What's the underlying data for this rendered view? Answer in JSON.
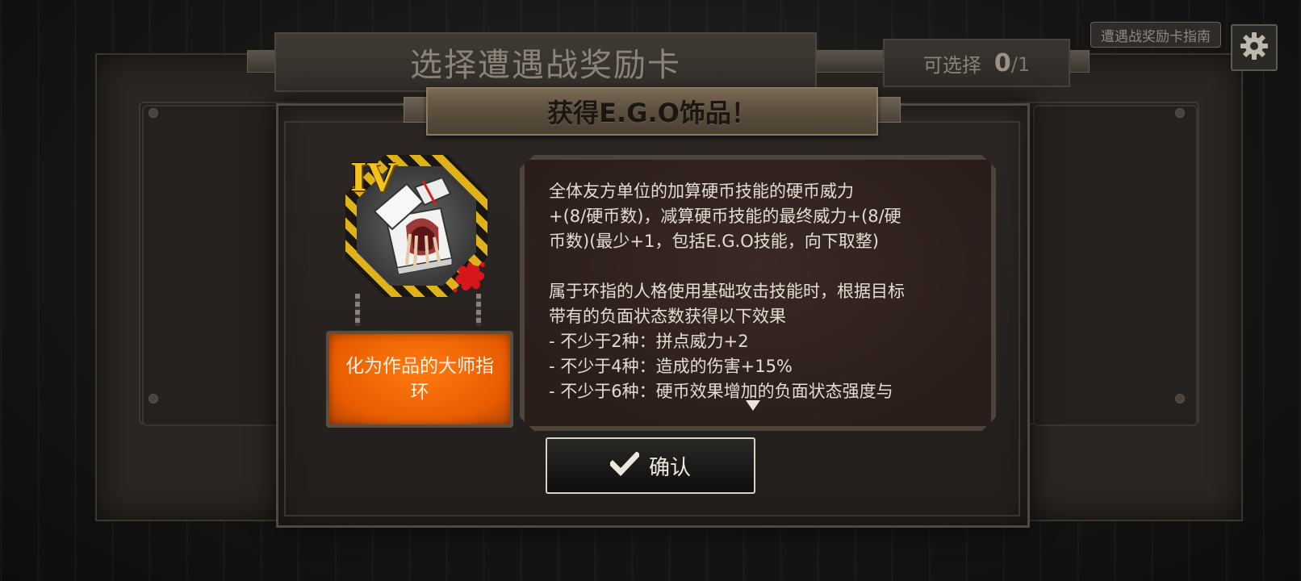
{
  "header": {
    "title": "选择遭遇战奖励卡",
    "selectable_label": "可选择",
    "selected_count": "0",
    "selectable_total": "/1",
    "guide_button_label": "遭遇战奖励卡指南",
    "settings_icon": "gear-icon"
  },
  "modal": {
    "title": "获得E.G.O饰品！",
    "item": {
      "tier": "IV",
      "name": "化为作品的大师指环",
      "icon": "box-ring-icon",
      "plate_color": "#ff6a00"
    },
    "description": {
      "para1": [
        "全体友方单位的加算硬币技能的硬币威力",
        "+(8/硬币数)，减算硬币技能的最终威力+(8/硬",
        "币数)(最少+1，包括E.G.O技能，向下取整)"
      ],
      "para2": [
        "属于环指的人格使用基础攻击技能时，根据目标",
        "带有的负面状态数获得以下效果",
        "- 不少于2种：拼点威力+2",
        "- 不少于4种：造成的伤害+15%",
        "- 不少于6种：硬币效果增加的负面状态强度与"
      ]
    },
    "confirm_label": "确认",
    "confirm_icon": "checkmark-icon"
  },
  "colors": {
    "tier_gold": "#f3c21b",
    "accent_orange": "#ff6a00"
  }
}
